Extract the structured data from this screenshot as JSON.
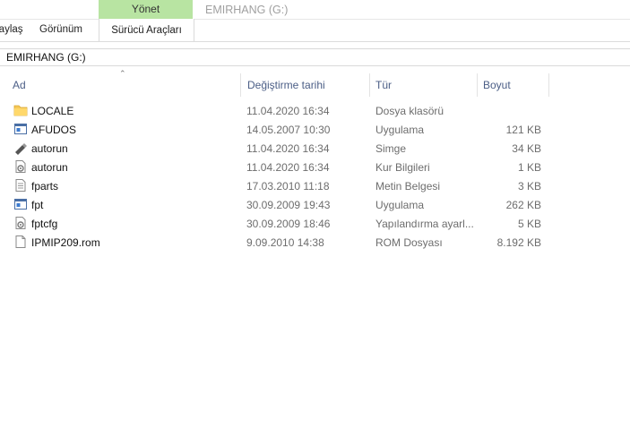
{
  "ribbon": {
    "manage_tab": "Yönet",
    "window_title": "EMIRHANG (G:)",
    "tabs": [
      "Paylaş",
      "Görünüm"
    ],
    "drive_tools_tab": "Sürücü Araçları"
  },
  "address": {
    "path": "EMIRHANG (G:)"
  },
  "columns": {
    "name": "Ad",
    "date": "Değiştirme tarihi",
    "type": "Tür",
    "size": "Boyut"
  },
  "files": [
    {
      "name": "LOCALE",
      "date": "11.04.2020 16:34",
      "type": "Dosya klasörü",
      "size": "",
      "icon": "folder-icon"
    },
    {
      "name": "AFUDOS",
      "date": "14.05.2007 10:30",
      "type": "Uygulama",
      "size": "121 KB",
      "icon": "application-icon"
    },
    {
      "name": "autorun",
      "date": "11.04.2020 16:34",
      "type": "Simge",
      "size": "34 KB",
      "icon": "usb-drive-icon"
    },
    {
      "name": "autorun",
      "date": "11.04.2020 16:34",
      "type": "Kur Bilgileri",
      "size": "1 KB",
      "icon": "setup-info-icon"
    },
    {
      "name": "fparts",
      "date": "17.03.2010 11:18",
      "type": "Metin Belgesi",
      "size": "3 KB",
      "icon": "text-document-icon"
    },
    {
      "name": "fpt",
      "date": "30.09.2009 19:43",
      "type": "Uygulama",
      "size": "262 KB",
      "icon": "application-icon"
    },
    {
      "name": "fptcfg",
      "date": "30.09.2009 18:46",
      "type": "Yapılandırma ayarl...",
      "size": "5 KB",
      "icon": "config-file-icon"
    },
    {
      "name": "IPMIP209.rom",
      "date": "9.09.2010 14:38",
      "type": "ROM Dosyası",
      "size": "8.192 KB",
      "icon": "file-icon"
    }
  ],
  "colors": {
    "manage_tab_bg": "#b8e4a2",
    "header_text": "#4b5e86",
    "folder": "#f6c858"
  }
}
